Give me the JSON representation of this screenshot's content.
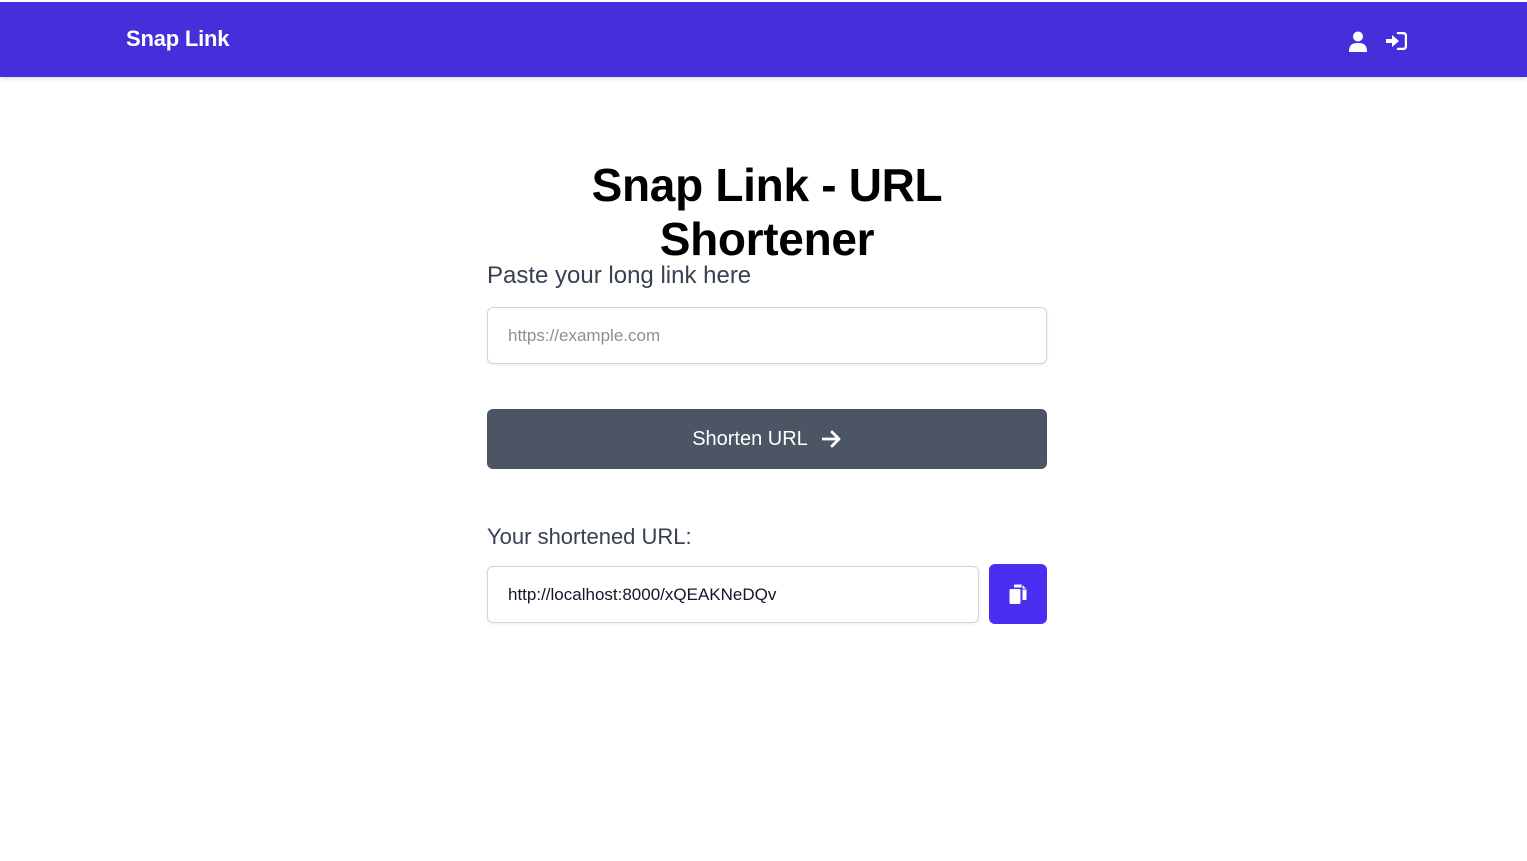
{
  "navbar": {
    "brand": "Snap Link",
    "icons": [
      "user-icon",
      "sign-in-icon"
    ],
    "background": "#452fdb"
  },
  "main": {
    "title": "Snap Link - URL Shortener",
    "long_link_label": "Paste your long link here",
    "long_link_placeholder": "https://example.com",
    "long_link_value": "",
    "shorten_button_label": "Shorten URL",
    "shortened_label": "Your shortened URL:",
    "shortened_value": "http://localhost:8000/xQEAKNeDQv",
    "copy_icon": "copy-icon"
  },
  "colors": {
    "accent": "#4b2ff0",
    "button_gray": "#4b5563"
  }
}
